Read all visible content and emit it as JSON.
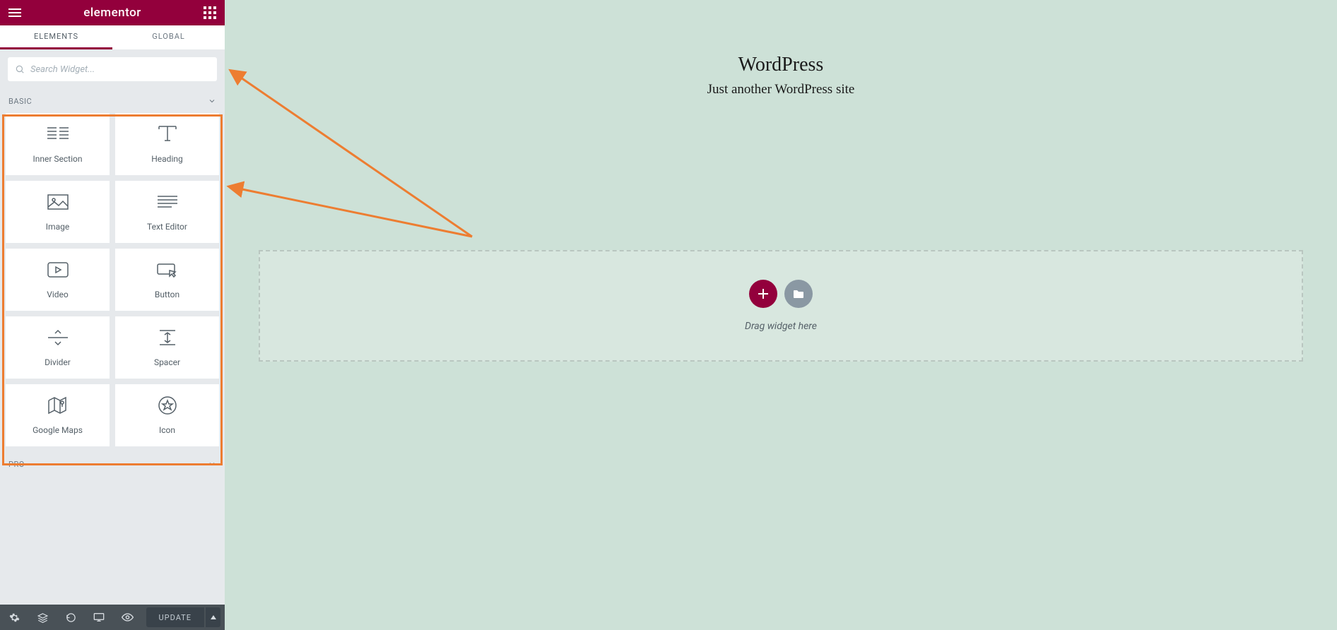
{
  "brand": "elementor",
  "tabs": {
    "elements": "ELEMENTS",
    "global": "GLOBAL"
  },
  "search": {
    "placeholder": "Search Widget..."
  },
  "categories": {
    "basic": "BASIC",
    "pro": "PRO"
  },
  "widgets": [
    {
      "id": "inner-section",
      "label": "Inner Section"
    },
    {
      "id": "heading",
      "label": "Heading"
    },
    {
      "id": "image",
      "label": "Image"
    },
    {
      "id": "text-editor",
      "label": "Text Editor"
    },
    {
      "id": "video",
      "label": "Video"
    },
    {
      "id": "button",
      "label": "Button"
    },
    {
      "id": "divider",
      "label": "Divider"
    },
    {
      "id": "spacer",
      "label": "Spacer"
    },
    {
      "id": "google-maps",
      "label": "Google Maps"
    },
    {
      "id": "icon",
      "label": "Icon"
    }
  ],
  "footer": {
    "update": "UPDATE"
  },
  "site": {
    "title": "WordPress",
    "tagline": "Just another WordPress site"
  },
  "dropzone": {
    "hint": "Drag widget here"
  },
  "colors": {
    "accent": "#93003c",
    "annotation": "#ed7d31"
  }
}
